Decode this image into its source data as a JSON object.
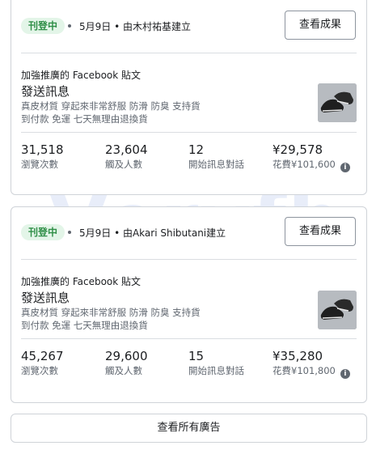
{
  "watermark": "Veryfb",
  "ads": [
    {
      "status": "刊登中",
      "meta": "5月9日 • 由木村祐基建立",
      "results_button": "查看成果",
      "boost_label": "加強推廣的 Facebook 貼文",
      "title": "發送訊息",
      "desc_line1": "真皮材質 穿起來非常舒服 防滑 防臭 支持貨",
      "desc_line2": "到付款 免運 七天無理由退換貨",
      "thumbnail_icon": "shoe-thumbnail",
      "stats": [
        {
          "value": "31,518",
          "label": "瀏覽次數"
        },
        {
          "value": "23,604",
          "label": "觸及人數"
        },
        {
          "value": "12",
          "label": "開始訊息對話"
        },
        {
          "value": "¥29,578",
          "label": "花費¥101,600"
        }
      ]
    },
    {
      "status": "刊登中",
      "meta": "5月9日 • 由Akari Shibutani建立",
      "results_button": "查看成果",
      "boost_label": "加強推廣的 Facebook 貼文",
      "title": "發送訊息",
      "desc_line1": "真皮材質 穿起來非常舒服 防滑 防臭 支持貨",
      "desc_line2": "到付款 免運 七天無理由退換貨",
      "thumbnail_icon": "shoe-thumbnail",
      "stats": [
        {
          "value": "45,267",
          "label": "瀏覽次數"
        },
        {
          "value": "29,600",
          "label": "觸及人數"
        },
        {
          "value": "15",
          "label": "開始訊息對話"
        },
        {
          "value": "¥35,280",
          "label": "花費¥101,800"
        }
      ]
    }
  ],
  "view_all_button": "查看所有廣告",
  "info_icon_glyph": "i"
}
